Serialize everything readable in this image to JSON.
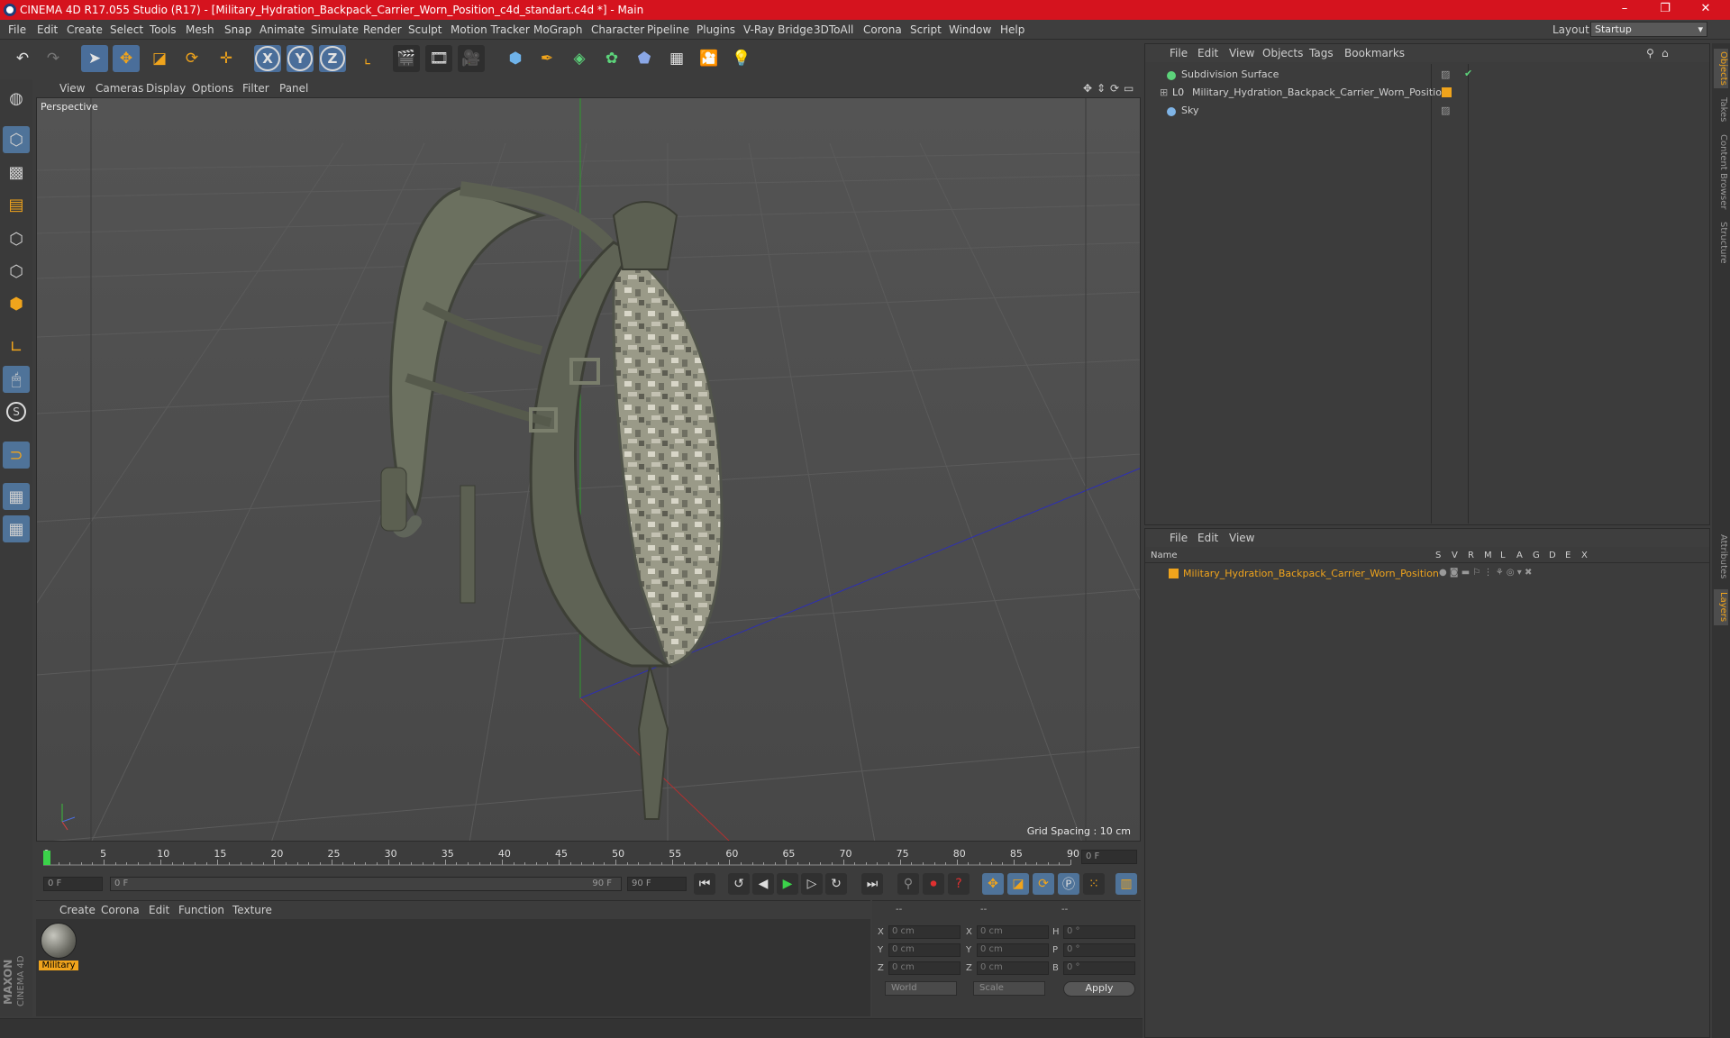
{
  "window": {
    "title": "CINEMA 4D R17.055 Studio (R17) - [Military_Hydration_Backpack_Carrier_Worn_Position_c4d_standart.c4d *] - Main",
    "minimize": "–",
    "maximize": "❐",
    "close": "✕"
  },
  "menubar": {
    "items": [
      "File",
      "Edit",
      "Create",
      "Select",
      "Tools",
      "Mesh",
      "Snap",
      "Animate",
      "Simulate",
      "Render",
      "Sculpt",
      "Motion Tracker",
      "MoGraph",
      "Character",
      "Pipeline",
      "Plugins",
      "V-Ray Bridge",
      "3DToAll",
      "Corona",
      "Script",
      "Window",
      "Help"
    ],
    "layout_label": "Layout:",
    "layout_value": "Startup"
  },
  "toolbar": {
    "undo": "↶",
    "redo": "↷",
    "x": "X",
    "y": "Y",
    "z": "Z"
  },
  "viewport": {
    "menu": [
      "View",
      "Cameras",
      "Display",
      "Options",
      "Filter",
      "Panel"
    ],
    "label": "Perspective",
    "grid_spacing": "Grid Spacing : 10 cm"
  },
  "timeline": {
    "ticks": [
      "0",
      "5",
      "10",
      "15",
      "20",
      "25",
      "30",
      "35",
      "40",
      "45",
      "50",
      "55",
      "60",
      "65",
      "70",
      "75",
      "80",
      "85",
      "90"
    ],
    "current_frame": "0 F",
    "start_field": "0 F",
    "range_start": "0 F",
    "range_end": "90 F",
    "end_field": "90 F"
  },
  "material_manager": {
    "menu": [
      "Create",
      "Corona",
      "Edit",
      "Function",
      "Texture"
    ],
    "material_name": "Military"
  },
  "coordinates": {
    "header": [
      "--",
      "--",
      "--"
    ],
    "rows": [
      {
        "l1": "X",
        "v1": "0 cm",
        "l2": "X",
        "v2": "0 cm",
        "l3": "H",
        "v3": "0 °"
      },
      {
        "l1": "Y",
        "v1": "0 cm",
        "l2": "Y",
        "v2": "0 cm",
        "l3": "P",
        "v3": "0 °"
      },
      {
        "l1": "Z",
        "v1": "0 cm",
        "l2": "Z",
        "v2": "0 cm",
        "l3": "B",
        "v3": "0 °"
      }
    ],
    "space": "World",
    "mode": "Scale",
    "apply": "Apply"
  },
  "object_manager": {
    "menu": [
      "File",
      "Edit",
      "View",
      "Objects",
      "Tags",
      "Bookmarks"
    ],
    "objects": [
      {
        "name": "Subdivision Surface"
      },
      {
        "name": "Military_Hydration_Backpack_Carrier_Worn_Position"
      },
      {
        "name": "Sky"
      }
    ]
  },
  "layer_manager": {
    "menu": [
      "File",
      "Edit",
      "View"
    ],
    "columns": [
      "Name",
      "S",
      "V",
      "R",
      "M",
      "L",
      "A",
      "G",
      "D",
      "E",
      "X"
    ],
    "layers": [
      {
        "name": "Military_Hydration_Backpack_Carrier_Worn_Position"
      }
    ]
  },
  "right_tabs": [
    "Objects",
    "Takes",
    "Content Browser",
    "Structure",
    "Attributes",
    "Layers"
  ],
  "branding": {
    "line1": "MAXON",
    "line2": "CINEMA 4D"
  },
  "colors": {
    "accent": "#f0a41c",
    "title_bar": "#d5131e",
    "tool_blue": "#4f7399"
  }
}
